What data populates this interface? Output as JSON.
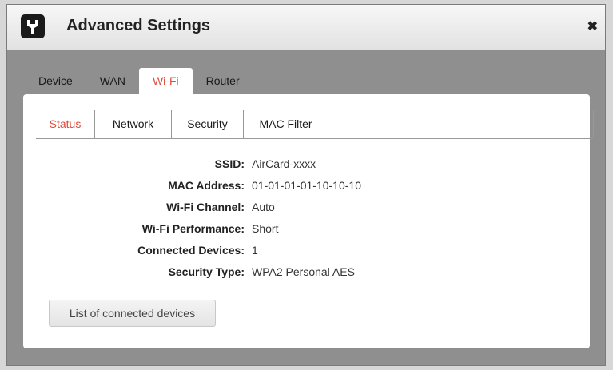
{
  "window": {
    "title": "Advanced Settings",
    "close_glyph": "✖",
    "icon": "wrench-icon"
  },
  "tabs": [
    {
      "label": "Device"
    },
    {
      "label": "WAN"
    },
    {
      "label": "Wi-Fi"
    },
    {
      "label": "Router"
    }
  ],
  "subtabs": [
    {
      "label": "Status"
    },
    {
      "label": "Network"
    },
    {
      "label": "Security"
    },
    {
      "label": "MAC Filter"
    }
  ],
  "status": {
    "ssid": {
      "label": "SSID:",
      "value": "AirCard-xxxx"
    },
    "mac": {
      "label": "MAC Address:",
      "value": "01-01-01-01-10-10-10"
    },
    "channel": {
      "label": "Wi-Fi Channel:",
      "value": "Auto"
    },
    "performance": {
      "label": "Wi-Fi Performance:",
      "value": "Short"
    },
    "devices": {
      "label": "Connected Devices:",
      "value": "1"
    },
    "security": {
      "label": "Security Type:",
      "value": "WPA2 Personal AES"
    }
  },
  "button": {
    "label": "List of connected devices"
  },
  "colors": {
    "accent": "#e24a3b",
    "background": "#8f8f8f"
  }
}
